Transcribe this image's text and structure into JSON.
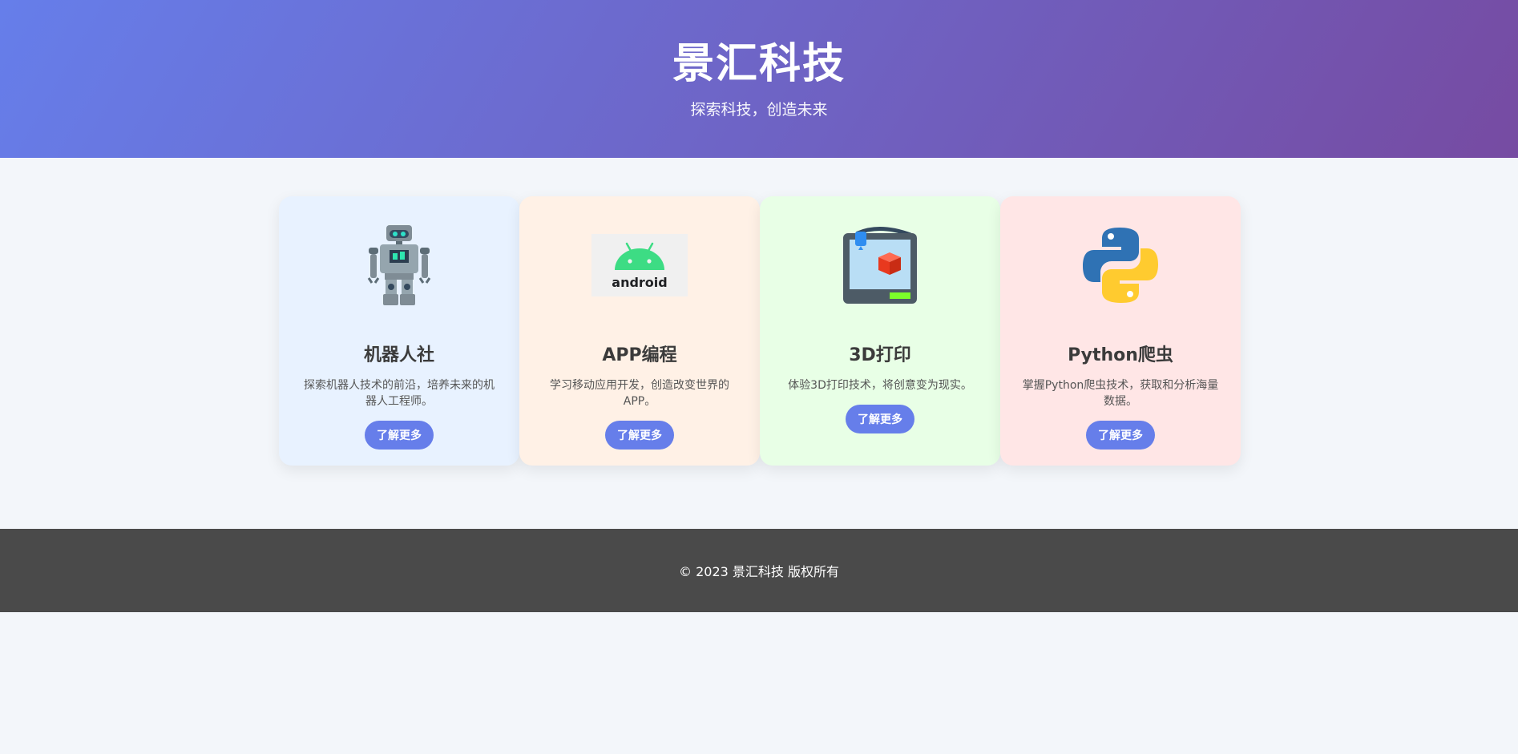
{
  "header": {
    "title": "景汇科技",
    "subtitle": "探索科技，创造未来",
    "gradient_start": "#667eea",
    "gradient_end": "#764ba2"
  },
  "cards": [
    {
      "icon": "robot-icon",
      "title": "机器人社",
      "description": "探索机器人技术的前沿，培养未来的机器人工程师。",
      "button": "了解更多",
      "bg": "#e8f2ff"
    },
    {
      "icon": "android-logo-icon",
      "logo_text": "android",
      "title": "APP编程",
      "description": "学习移动应用开发，创造改变世界的APP。",
      "button": "了解更多",
      "bg": "#fff1e6"
    },
    {
      "icon": "3d-printer-icon",
      "title": "3D打印",
      "description": "体验3D打印技术，将创意变为现实。",
      "button": "了解更多",
      "bg": "#e8ffe6"
    },
    {
      "icon": "python-logo-icon",
      "title": "Python爬虫",
      "description": "掌握Python爬虫技术，获取和分析海量数据。",
      "button": "了解更多",
      "bg": "#ffe6e6"
    }
  ],
  "footer": {
    "text": "© 2023 景汇科技 版权所有"
  },
  "colors": {
    "accent": "#667eea",
    "page_bg": "#f3f6fa",
    "footer_bg": "#4a4a4a"
  }
}
